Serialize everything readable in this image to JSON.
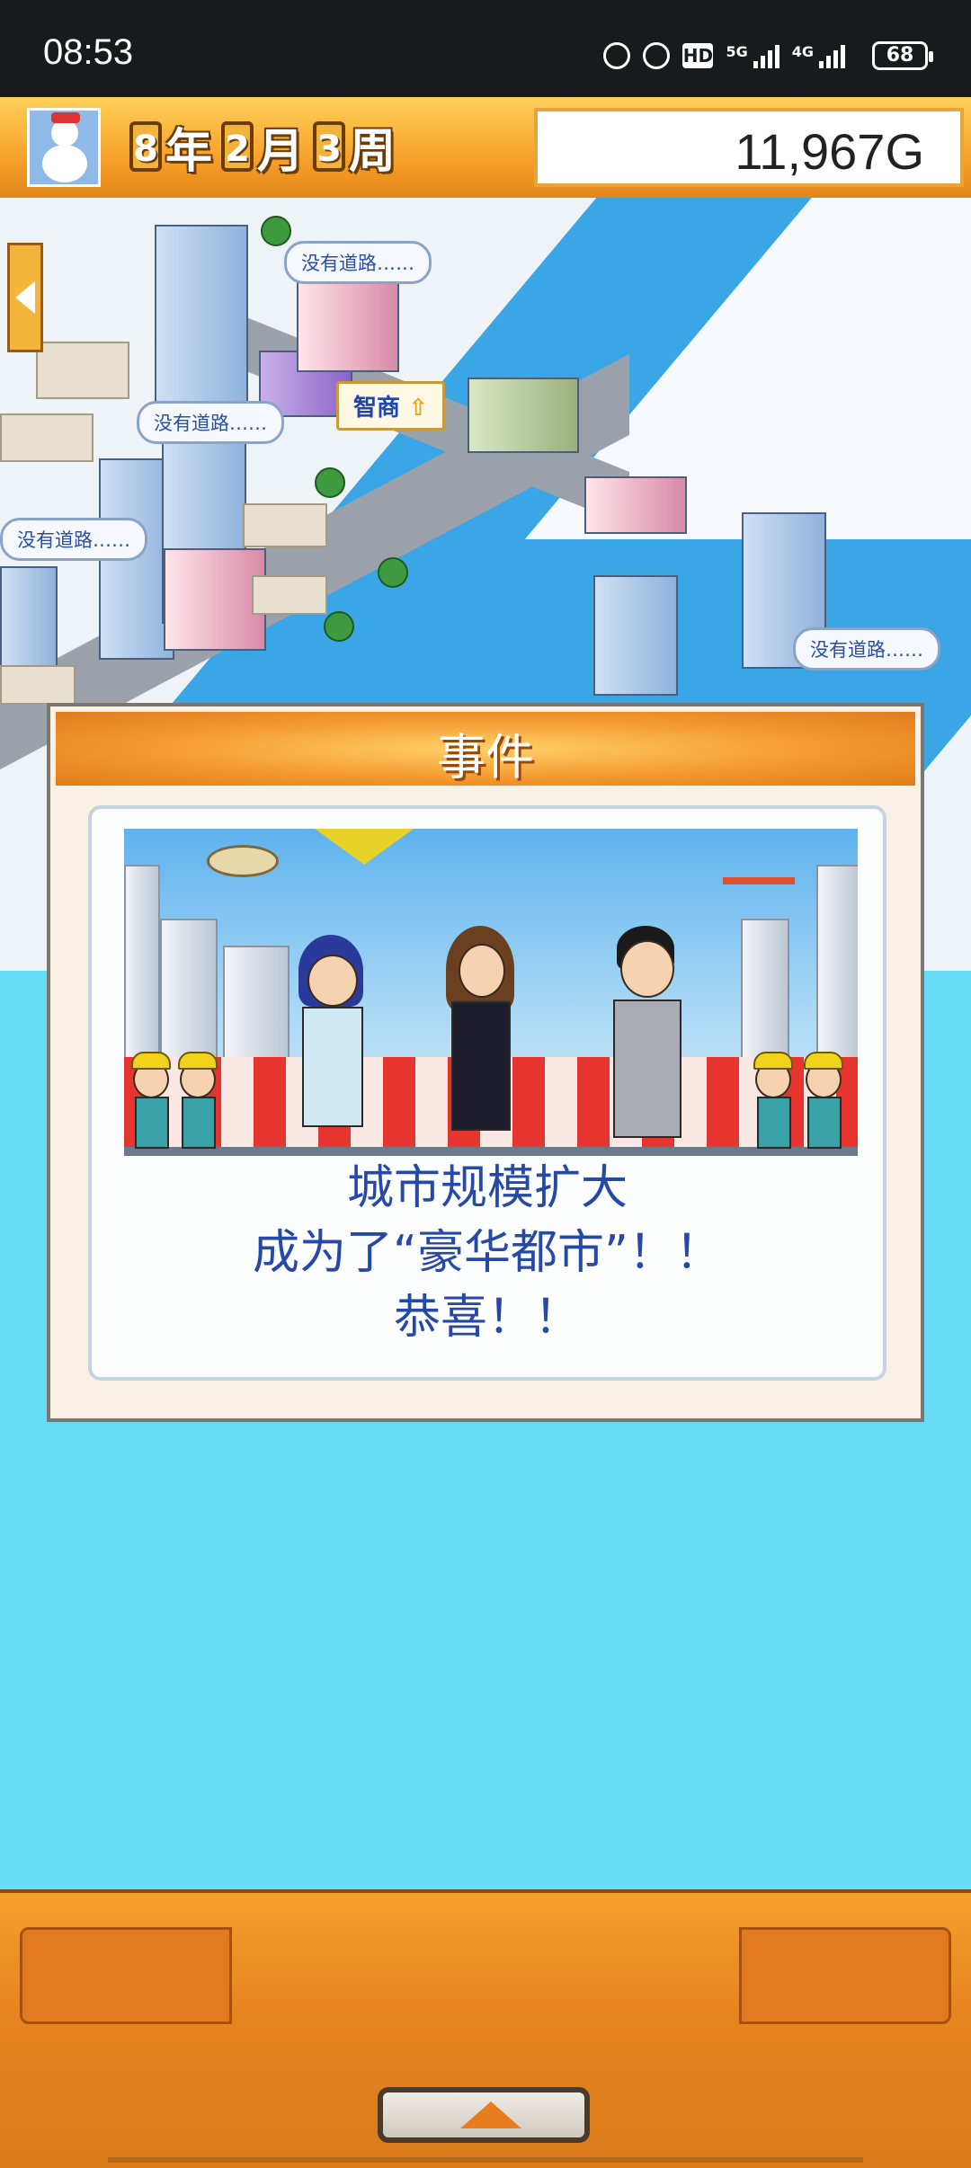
{
  "status_bar": {
    "time": "08:53",
    "network_1": "5G",
    "network_2": "4G",
    "hd_label": "HD",
    "battery": "68",
    "icons": [
      "headphones-icon",
      "alarm-icon",
      "hd-icon",
      "signal-5g-icon",
      "signal-4g-icon",
      "battery-icon"
    ]
  },
  "header": {
    "year_num": "8",
    "year_unit": "年",
    "month_num": "2",
    "month_unit": "月",
    "week_num": "3",
    "week_unit": "周",
    "money": "11,967G",
    "avatar": "snowman-icon"
  },
  "map": {
    "bubbles": [
      "没有道路……",
      "没有道路……",
      "没有道路……",
      "没有道路……"
    ],
    "biz_bubble": "智商"
  },
  "event": {
    "title": "事件",
    "lines": [
      "城市规模扩大",
      "成为了“豪华都市”！！",
      "恭喜！！"
    ]
  },
  "colors": {
    "accent_orange": "#f49a30",
    "sky_background": "#68dcf5",
    "event_text": "#2648a6"
  }
}
